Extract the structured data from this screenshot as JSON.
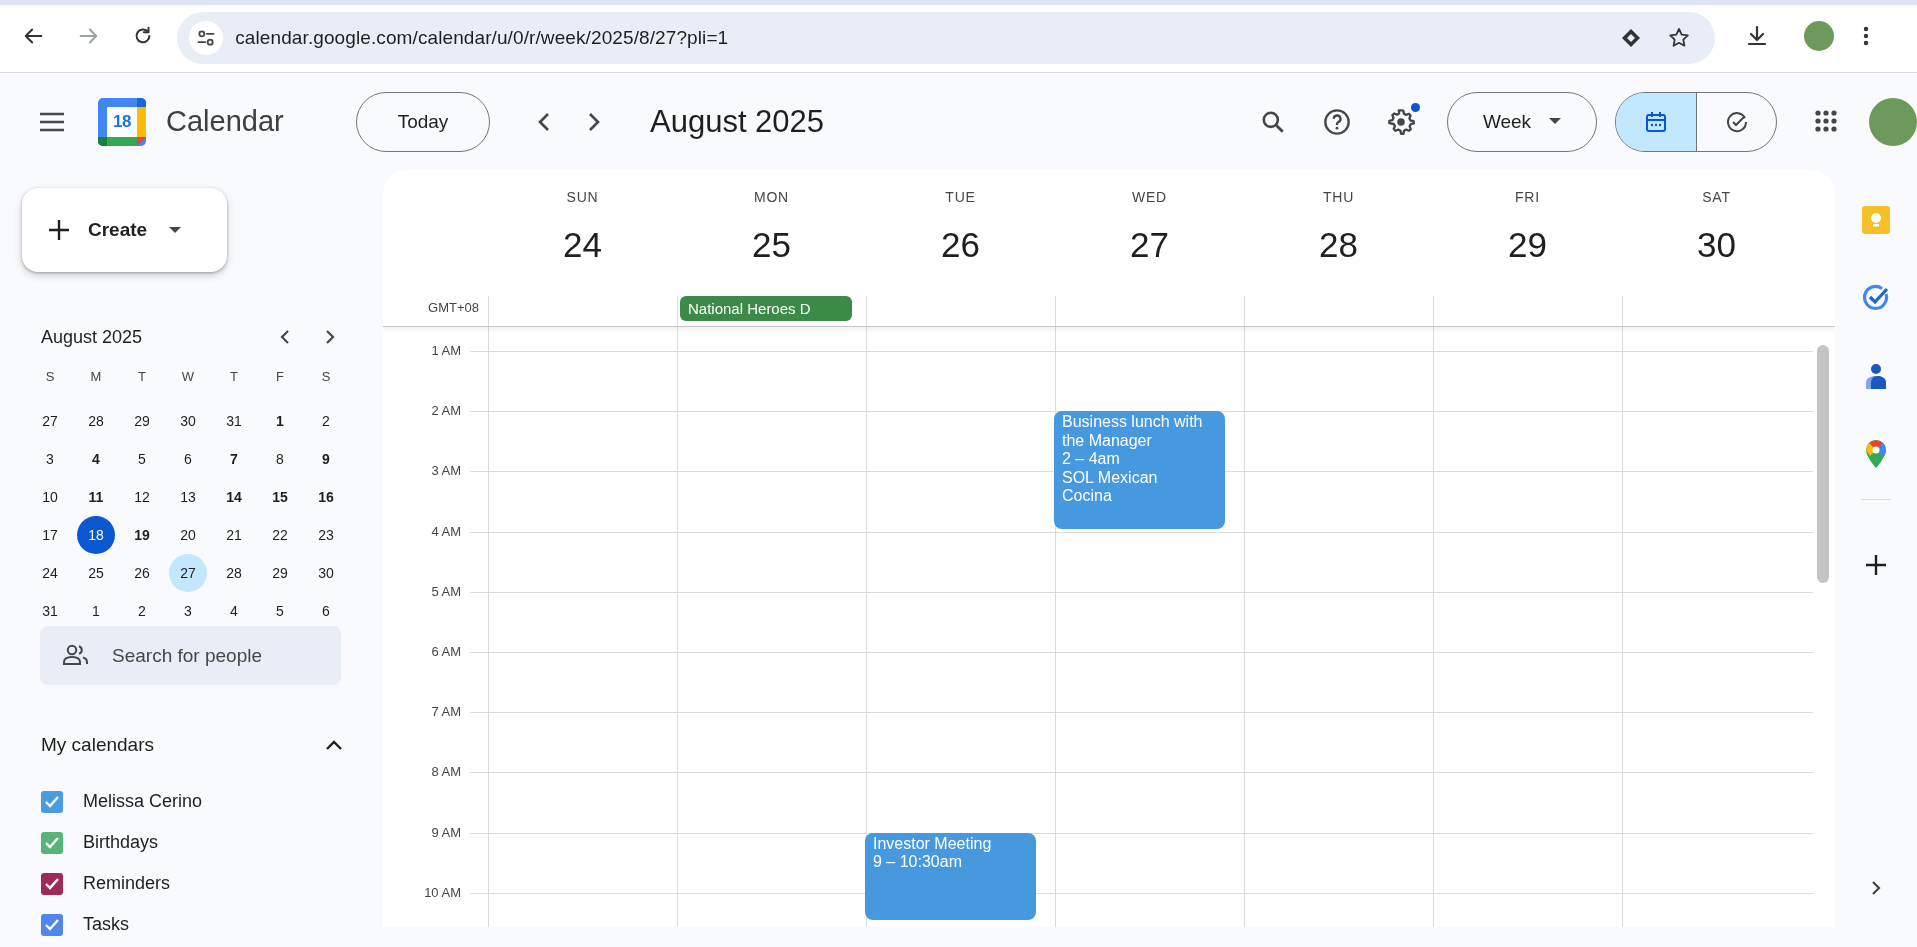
{
  "browser": {
    "url": "calendar.google.com/calendar/u/0/r/week/2025/8/27?pli=1"
  },
  "header": {
    "logo_day": "18",
    "app_name": "Calendar",
    "today_button": "Today",
    "title": "August 2025",
    "settings_notification": true,
    "view_button": "Week",
    "view_toggle": [
      {
        "kind": "calendar",
        "selected": true
      },
      {
        "kind": "tasks",
        "selected": false
      }
    ]
  },
  "sidebar": {
    "create_button": "Create",
    "mini_calendar": {
      "title": "August 2025",
      "weekdays": [
        "S",
        "M",
        "T",
        "W",
        "T",
        "F",
        "S"
      ],
      "days": [
        {
          "label": "27",
          "bold": false,
          "today": false,
          "selected": false
        },
        {
          "label": "28",
          "bold": false,
          "today": false,
          "selected": false
        },
        {
          "label": "29",
          "bold": false,
          "today": false,
          "selected": false
        },
        {
          "label": "30",
          "bold": false,
          "today": false,
          "selected": false
        },
        {
          "label": "31",
          "bold": false,
          "today": false,
          "selected": false
        },
        {
          "label": "1",
          "bold": true,
          "today": false,
          "selected": false
        },
        {
          "label": "2",
          "bold": false,
          "today": false,
          "selected": false
        },
        {
          "label": "3",
          "bold": false,
          "today": false,
          "selected": false
        },
        {
          "label": "4",
          "bold": true,
          "today": false,
          "selected": false
        },
        {
          "label": "5",
          "bold": false,
          "today": false,
          "selected": false
        },
        {
          "label": "6",
          "bold": false,
          "today": false,
          "selected": false
        },
        {
          "label": "7",
          "bold": true,
          "today": false,
          "selected": false
        },
        {
          "label": "8",
          "bold": false,
          "today": false,
          "selected": false
        },
        {
          "label": "9",
          "bold": true,
          "today": false,
          "selected": false
        },
        {
          "label": "10",
          "bold": false,
          "today": false,
          "selected": false
        },
        {
          "label": "11",
          "bold": true,
          "today": false,
          "selected": false
        },
        {
          "label": "12",
          "bold": false,
          "today": false,
          "selected": false
        },
        {
          "label": "13",
          "bold": false,
          "today": false,
          "selected": false
        },
        {
          "label": "14",
          "bold": true,
          "today": false,
          "selected": false
        },
        {
          "label": "15",
          "bold": true,
          "today": false,
          "selected": false
        },
        {
          "label": "16",
          "bold": true,
          "today": false,
          "selected": false
        },
        {
          "label": "17",
          "bold": false,
          "today": false,
          "selected": false
        },
        {
          "label": "18",
          "bold": false,
          "today": true,
          "selected": false
        },
        {
          "label": "19",
          "bold": true,
          "today": false,
          "selected": false
        },
        {
          "label": "20",
          "bold": false,
          "today": false,
          "selected": false
        },
        {
          "label": "21",
          "bold": false,
          "today": false,
          "selected": false
        },
        {
          "label": "22",
          "bold": false,
          "today": false,
          "selected": false
        },
        {
          "label": "23",
          "bold": false,
          "today": false,
          "selected": false
        },
        {
          "label": "24",
          "bold": false,
          "today": false,
          "selected": false
        },
        {
          "label": "25",
          "bold": false,
          "today": false,
          "selected": false
        },
        {
          "label": "26",
          "bold": false,
          "today": false,
          "selected": false
        },
        {
          "label": "27",
          "bold": false,
          "today": false,
          "selected": true
        },
        {
          "label": "28",
          "bold": false,
          "today": false,
          "selected": false
        },
        {
          "label": "29",
          "bold": false,
          "today": false,
          "selected": false
        },
        {
          "label": "30",
          "bold": false,
          "today": false,
          "selected": false
        },
        {
          "label": "31",
          "bold": false,
          "today": false,
          "selected": false
        },
        {
          "label": "1",
          "bold": false,
          "today": false,
          "selected": false
        },
        {
          "label": "2",
          "bold": false,
          "today": false,
          "selected": false
        },
        {
          "label": "3",
          "bold": false,
          "today": false,
          "selected": false
        },
        {
          "label": "4",
          "bold": false,
          "today": false,
          "selected": false
        },
        {
          "label": "5",
          "bold": false,
          "today": false,
          "selected": false
        },
        {
          "label": "6",
          "bold": false,
          "today": false,
          "selected": false
        }
      ]
    },
    "people_search": {
      "placeholder": "Search for people"
    },
    "my_calendars": {
      "title": "My calendars",
      "expanded": true,
      "items": [
        {
          "name": "Melissa Cerino",
          "checked": true,
          "color": "#4a9be0"
        },
        {
          "name": "Birthdays",
          "checked": true,
          "color": "#57b47a"
        },
        {
          "name": "Reminders",
          "checked": true,
          "color": "#9e2a59"
        },
        {
          "name": "Tasks",
          "checked": true,
          "color": "#4f86e8"
        }
      ]
    }
  },
  "week": {
    "timezone": "GMT+08",
    "days": [
      {
        "name": "SUN",
        "number": "24"
      },
      {
        "name": "MON",
        "number": "25",
        "all_day": [
          {
            "title": "National Heroes D",
            "color": "#3b8a48"
          }
        ]
      },
      {
        "name": "TUE",
        "number": "26",
        "events": [
          {
            "title": "Investor Meeting",
            "time": "9 – 10:30am",
            "color": "#4699df"
          }
        ]
      },
      {
        "name": "WED",
        "number": "27",
        "events": [
          {
            "title": "Business lunch with the Manager",
            "time": "2 – 4am",
            "location": "SOL Mexican Cocina",
            "color": "#4699df"
          }
        ]
      },
      {
        "name": "THU",
        "number": "28"
      },
      {
        "name": "FRI",
        "number": "29"
      },
      {
        "name": "SAT",
        "number": "30"
      }
    ],
    "hours": [
      "1 AM",
      "2 AM",
      "3 AM",
      "4 AM",
      "5 AM",
      "6 AM",
      "7 AM",
      "8 AM",
      "9 AM",
      "10 AM"
    ]
  }
}
